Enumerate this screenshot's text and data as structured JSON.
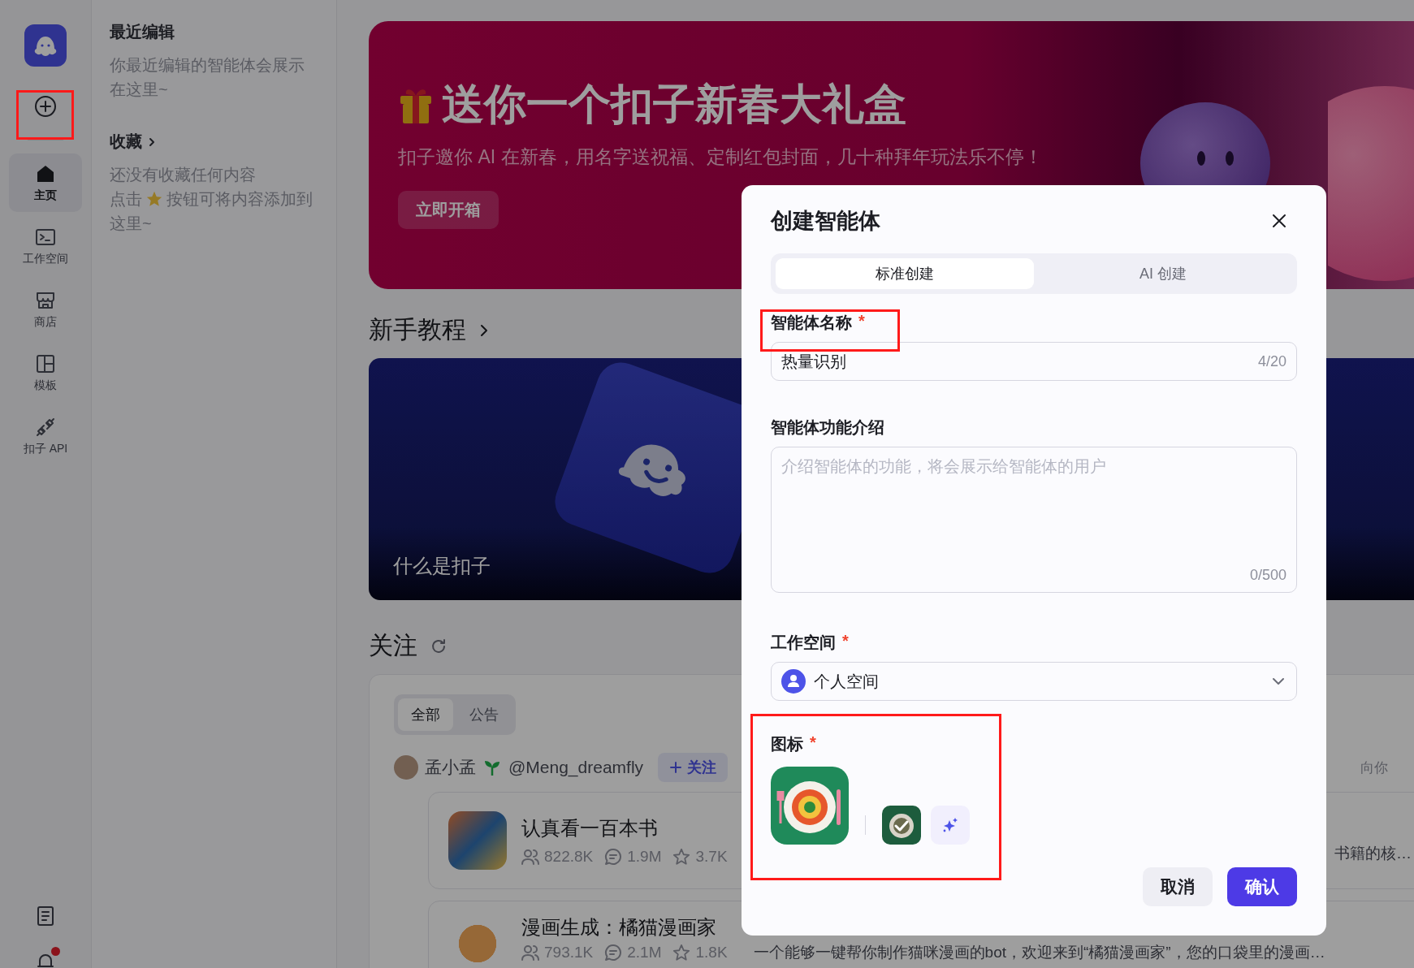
{
  "rail": {
    "nav": [
      {
        "label": "主页",
        "selected": true
      },
      {
        "label": "工作空间",
        "selected": false
      },
      {
        "label": "商店",
        "selected": false
      },
      {
        "label": "模板",
        "selected": false
      },
      {
        "label": "扣子 API",
        "selected": false
      }
    ],
    "notification_unread": true
  },
  "sidebar": {
    "recent": {
      "title": "最近编辑",
      "empty_text": "你最近编辑的智能体会展示在这里~"
    },
    "favorites": {
      "title": "收藏",
      "empty_text": "还没有收藏任何内容",
      "hint_before": "点击",
      "hint_after": "按钮可将内容添加到",
      "hint_continued": "这里~"
    }
  },
  "banner": {
    "title": "送你一个扣子新春大礼盒",
    "subtitle": "扣子邀你 AI 在新春，用名字送祝福、定制红包封面，几十种拜年玩法乐不停！",
    "button": "立即开箱"
  },
  "tutorials": {
    "heading": "新手教程",
    "cards": [
      {
        "caption": "什么是扣子"
      }
    ]
  },
  "follow": {
    "heading": "关注",
    "tabs": [
      {
        "label": "全部",
        "selected": true
      },
      {
        "label": "公告",
        "selected": false
      }
    ],
    "author": {
      "name": "孟小孟",
      "handle": "@Meng_dreamfly",
      "follow_button": "关注"
    },
    "side_text": "向你",
    "posts": [
      {
        "title": "认真看一百本书",
        "users": "822.8K",
        "comments": "1.9M",
        "favorites": "3.7K",
        "description": "书籍的核…"
      },
      {
        "title": "漫画生成：橘猫漫画家",
        "users": "793.1K",
        "comments": "2.1M",
        "favorites": "1.8K",
        "description": "一个能够一键帮你制作猫咪漫画的bot，欢迎来到“橘猫漫画家”，您的口袋里的漫画…"
      }
    ]
  },
  "dialog": {
    "title": "创建智能体",
    "tabs": [
      {
        "label": "标准创建",
        "selected": true
      },
      {
        "label": "AI 创建",
        "selected": false
      }
    ],
    "fields": [
      {
        "kind": "text",
        "label": "智能体名称",
        "required_mark": "*",
        "value": "热量识别",
        "counter": "4/20"
      },
      {
        "kind": "textarea",
        "label": "智能体功能介绍",
        "placeholder": "介绍智能体的功能，将会展示给智能体的用户",
        "counter": "0/500"
      },
      {
        "kind": "select",
        "label": "工作空间",
        "required_mark": "*",
        "value": "个人空间"
      },
      {
        "kind": "icon",
        "label": "图标",
        "required_mark": "*",
        "options": [
          {
            "kind": "image",
            "selected": true
          },
          {
            "kind": "generate",
            "selected": false
          }
        ]
      }
    ],
    "buttons": [
      {
        "label": "取消",
        "kind": "secondary"
      },
      {
        "label": "确认",
        "kind": "primary"
      }
    ]
  }
}
